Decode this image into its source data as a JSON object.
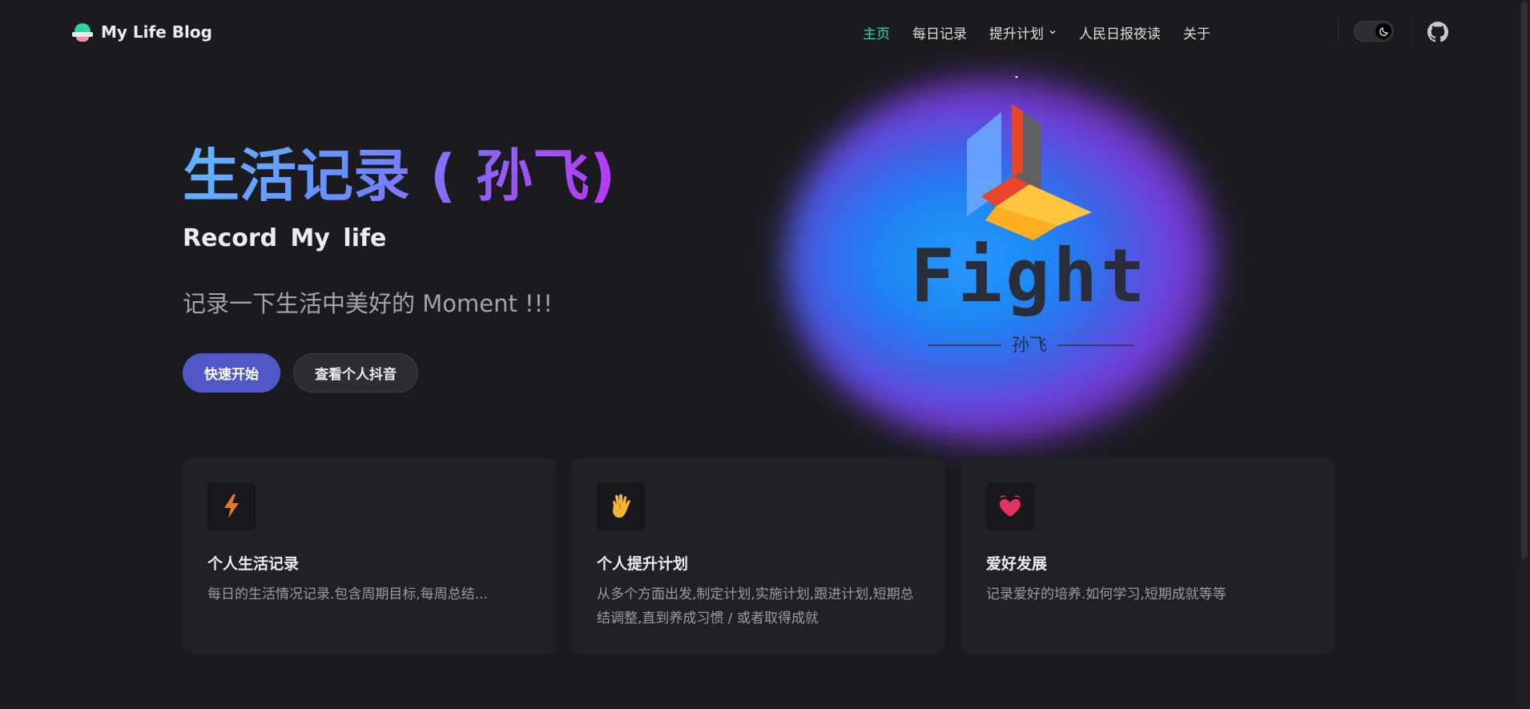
{
  "brand": {
    "name": "My Life Blog",
    "icon": "ufo-logo-icon"
  },
  "nav": {
    "items": [
      {
        "label": "主页",
        "active": true
      },
      {
        "label": "每日记录",
        "active": false
      },
      {
        "label": "提升计划",
        "active": false,
        "dropdown": true
      },
      {
        "label": "人民日报夜读",
        "active": false
      },
      {
        "label": "关于",
        "active": false
      }
    ],
    "theme_toggle_icon": "moon-icon",
    "github_icon": "github-icon"
  },
  "hero": {
    "title": "生活记录 ( 孙飞)",
    "subtitle": "Record  My life",
    "tagline": "记录一下生活中美好的 Moment !!!",
    "primary_button": "快速开始",
    "secondary_button": "查看个人抖音",
    "image": {
      "word": "Fight",
      "signature": "孙飞"
    }
  },
  "features": [
    {
      "icon": "lightning-icon",
      "title": "个人生活记录",
      "desc": "每日的生活情况记录.包含周期目标,每周总结..."
    },
    {
      "icon": "vulcan-hand-icon",
      "title": "个人提升计划",
      "desc": "从多个方面出发,制定计划,实施计划,跟进计划,短期总结调整,直到养成习惯 / 或者取得成就"
    },
    {
      "icon": "beating-heart-icon",
      "title": "爱好发展",
      "desc": "记录爱好的培养.如何学习,短期成就等等"
    }
  ],
  "colors": {
    "background": "#1b1b1f",
    "accent_active": "#2fdb9b",
    "primary_button": "#5058c8",
    "card": "#202127"
  }
}
